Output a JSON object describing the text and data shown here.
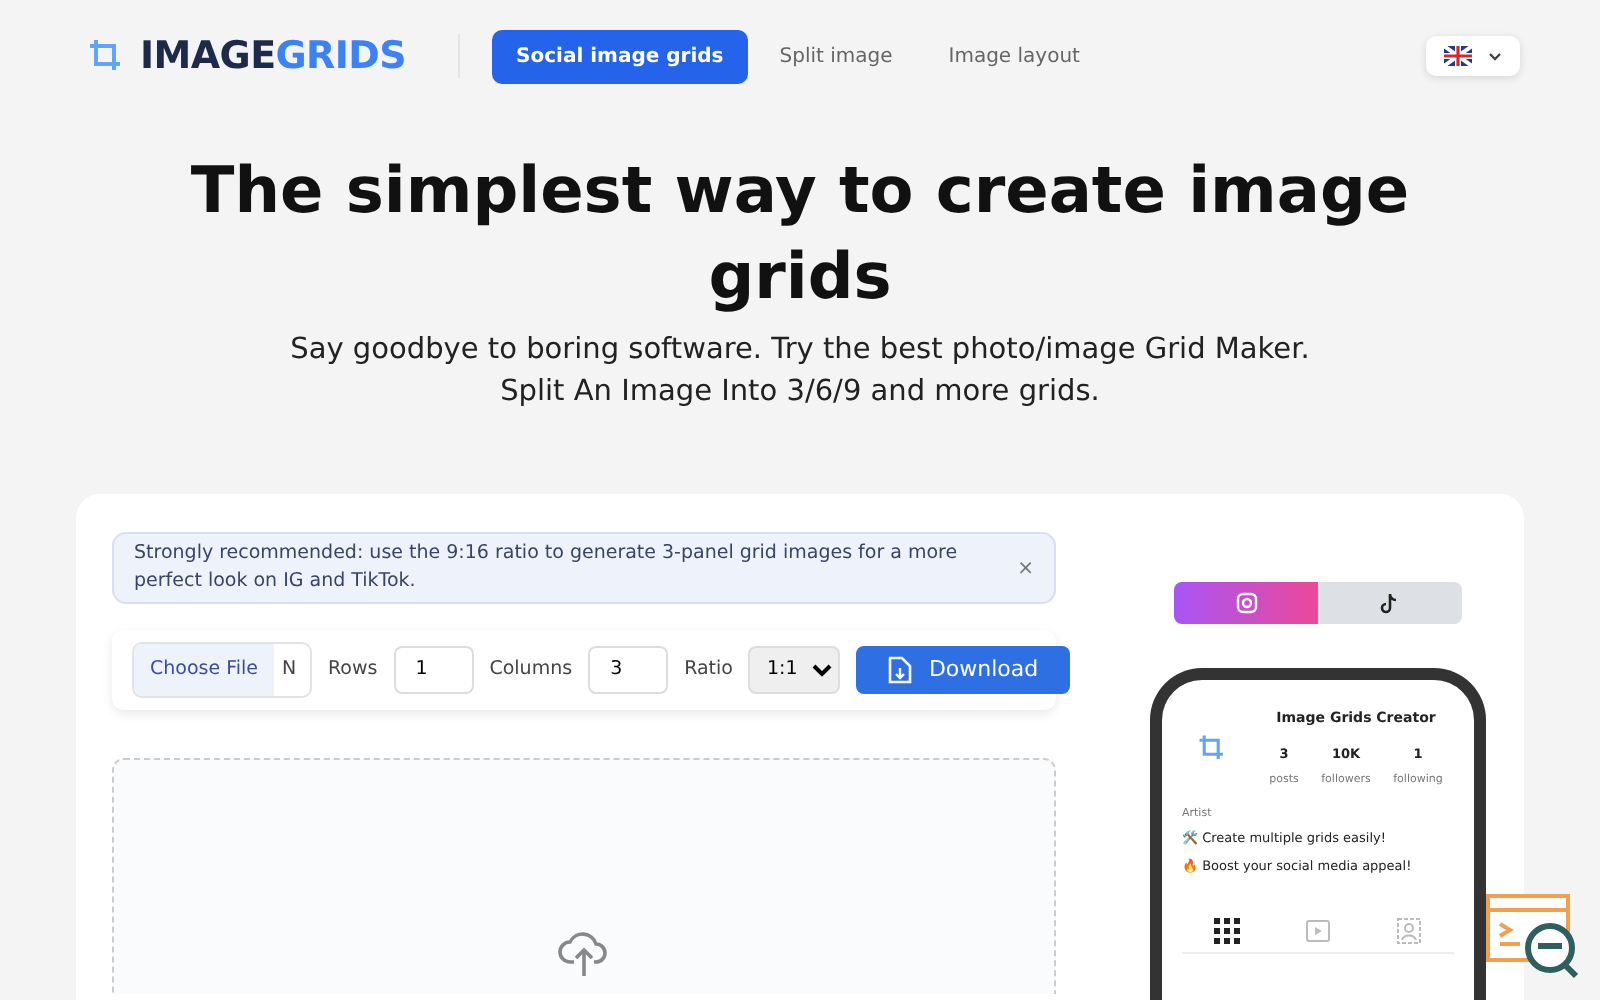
{
  "brand": {
    "part_1": "IMAGE",
    "part_2": "GRIDS"
  },
  "nav": [
    {
      "label": "Social image grids",
      "selected": true
    },
    {
      "label": "Split image",
      "selected": false
    },
    {
      "label": "Image layout",
      "selected": false
    }
  ],
  "hero": {
    "title": "The simplest way to create image grids",
    "subtitle_1": "Say goodbye to boring software. Try the best photo/image Grid Maker.",
    "subtitle_2": "Split An Image Into 3/6/9 and more grids."
  },
  "alert": {
    "text": "Strongly recommended: use the 9:16 ratio to generate 3-panel grid images for a more perfect look on IG and TikTok.",
    "close": "×"
  },
  "toolbar": {
    "file_button": "Choose File",
    "file_status": "N",
    "rows_label": "Rows",
    "rows": "1",
    "columns_label": "Columns",
    "columns": "3",
    "ratio_label": "Ratio",
    "ratio": "1:1",
    "download": "Download"
  },
  "platforms": [
    {
      "kind": "instagram",
      "selected": true
    },
    {
      "kind": "tiktok",
      "selected": false
    }
  ],
  "profile": {
    "name": "Image Grids Creator",
    "stats": [
      {
        "value": "3",
        "label": "posts"
      },
      {
        "value": "10K",
        "label": "followers"
      },
      {
        "value": "1",
        "label": "following"
      }
    ],
    "category": "Artist",
    "bio": [
      "🛠️ Create multiple grids easily!",
      "🔥 Boost your social media appeal!"
    ],
    "tabs": [
      {
        "kind": "grid",
        "selected": true
      },
      {
        "kind": "reels",
        "selected": false
      },
      {
        "kind": "tagged",
        "selected": false
      }
    ]
  }
}
